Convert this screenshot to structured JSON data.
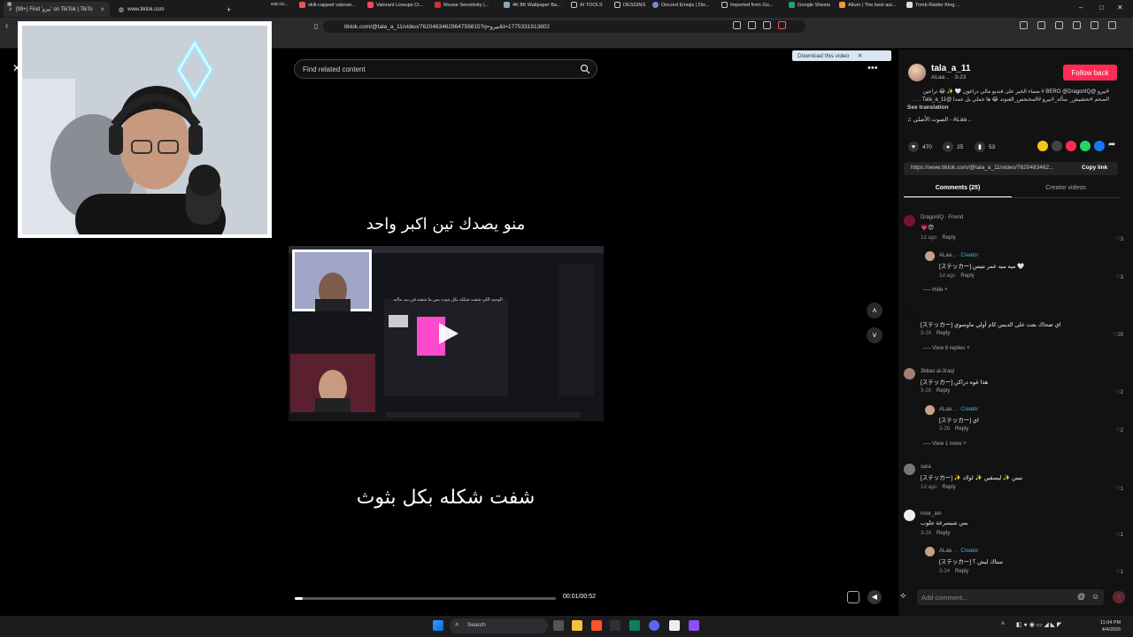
{
  "browser": {
    "tabs": [
      {
        "label": "(99+) Find 'بيرو' on TikTok | TikTo",
        "active": true
      },
      {
        "label": "www.tiktok.com",
        "active": false
      }
    ],
    "url": "tiktok.com/@tala_a_11/video/7620483462964759815?q=بيرو&t=1775331913802",
    "bookmarks": [
      "skill-capped valoran...",
      "Valorant Lineups Cr...",
      "Mouse Sensitivity |...",
      "4K 8K Wallpaper Ba...",
      "AI TOOLS",
      "DESGINS",
      "Discord Emojis | Dis...",
      "Imported from Go...",
      "Google Sheets",
      "Altum | The best aut...",
      "Tomb Raider King ..."
    ],
    "bookmark_partial": "eat.co..."
  },
  "video": {
    "search_placeholder": "Find related content",
    "caption_top": "منو يصدك تين اكبر واحد",
    "caption_bottom": "شفت شكله بكل بثوث",
    "time": "00:01/00:52",
    "progress": 0.03,
    "screen_text": "الوحيد اللي شفت شكله بكل بثوث بس ما شفته في يت مالته"
  },
  "download_banner": "Download this video",
  "panel": {
    "username": "tala_a_11",
    "nick": "ALaa .. · 3-23",
    "follow": "Follow back",
    "description": "#بيرو @BERO @DragonIQ # مساء الخير على فنديو مالي دراغون 🤍 ✨ 😂 تراعين الصحم #تحشيش_ سألة_#بيرو #المحنجص_العنوند 😂 ها جملي بل عمدا @Tala_a_11 . . . #مجند_فكاتة 😂",
    "see_translation": "See translation",
    "music": "الصوت الأصلي - ALaa ..",
    "likes": "470",
    "comments": "25",
    "saves": "53",
    "link": "https://www.tiktok.com/@tala_a_11/video/7620483462...",
    "copy_link": "Copy link",
    "tab_comments": "Comments (25)",
    "tab_creator": "Creator videos",
    "add_comment": "Add comment...",
    "comment_list": [
      {
        "name": "DragonIQ · Friend",
        "text": "💗😍",
        "meta": "1d ago",
        "reply": "Reply",
        "likes": "3"
      },
      {
        "name": "ALaa .. · ",
        "creator": "Creator",
        "text": "[ステッカー] ميه ميه عمر تتيس 🤍",
        "meta": "1d ago",
        "reply": "Reply",
        "likes": "3"
      },
      {
        "more": "Hide"
      },
      {
        "name": "",
        "text": "[ステッカー] اي صحاك بعت على الديس كام أولي ماوسوي",
        "meta": "3-24",
        "reply": "Reply",
        "likes": "29"
      },
      {
        "more": "View 8 replies"
      },
      {
        "name": "3bbas al-3raqi",
        "text": "[ステッカー] هذا غوه دراكن",
        "meta": "3-26",
        "reply": "Reply",
        "likes": "2"
      },
      {
        "name": "ALaa .. · ",
        "creator": "Creator",
        "text": "[ステッカー] اي",
        "meta": "3-26",
        "reply": "Reply",
        "likes": "2"
      },
      {
        "more": "View 1 more"
      },
      {
        "name": "sara",
        "text": "[ステッカー] ✨ تيس ✨ ليسقين ✨ لولاد",
        "meta": "1d ago",
        "reply": "Reply",
        "likes": "1"
      },
      {
        "name": "noor_am",
        "text": "بس شيسرعة جلوب",
        "meta": "3-24",
        "reply": "Reply",
        "likes": "1"
      },
      {
        "name": "ALaa .. · ",
        "creator": "Creator",
        "text": "[ステッカー] ستاك ليش ؟",
        "meta": "3-24",
        "reply": "Reply",
        "likes": "1"
      }
    ]
  },
  "taskbar": {
    "search": "Search",
    "time": "11:04 PM",
    "date": "4/4/2026"
  },
  "colors": {
    "accent": "#fe2c55",
    "creator": "#2bc0e4",
    "panel_bg": "#121212"
  }
}
